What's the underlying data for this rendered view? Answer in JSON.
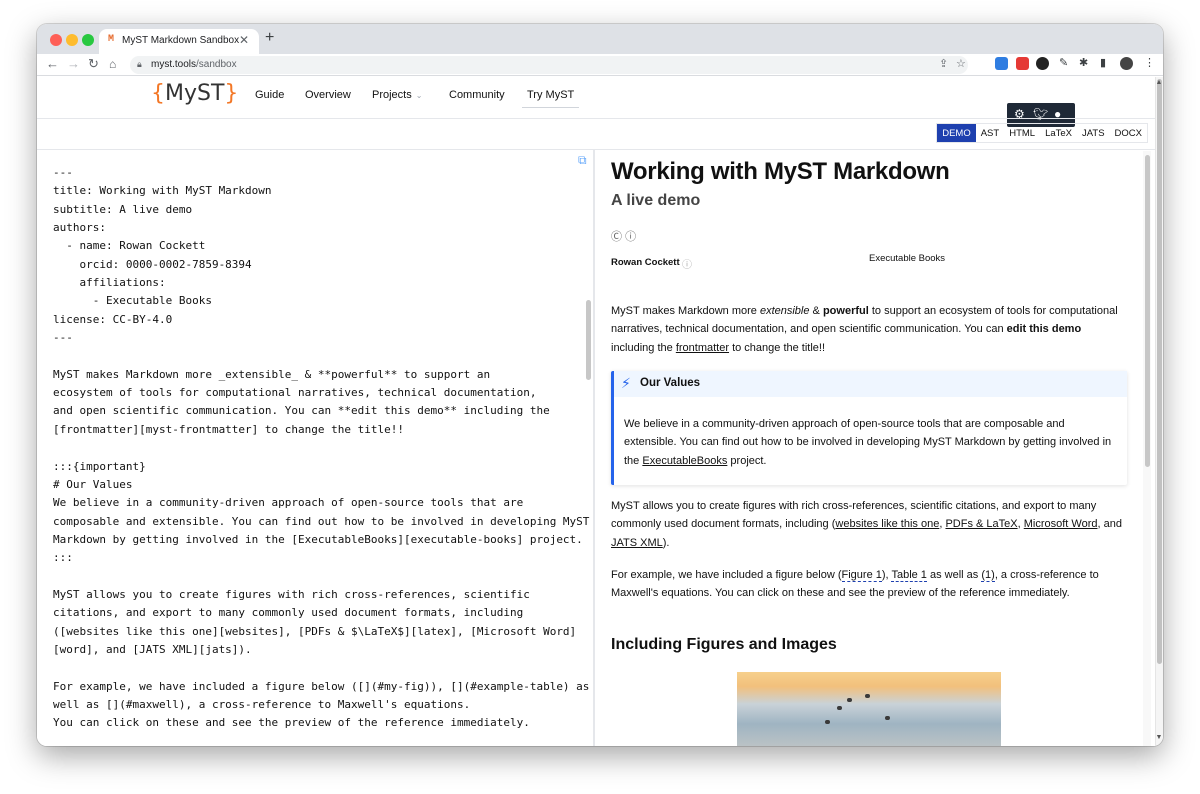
{
  "browser": {
    "tab_title": "MyST Markdown Sandbox",
    "tab_favicon": "M",
    "url_domain": "myst.tools",
    "url_path": "/sandbox"
  },
  "site": {
    "logo_left": "{",
    "logo_text": "MyST",
    "logo_right": "}",
    "nav": {
      "guide": "Guide",
      "overview": "Overview",
      "projects": "Projects",
      "community": "Community",
      "try": "Try MyST"
    }
  },
  "formats": [
    "DEMO",
    "AST",
    "HTML",
    "LaTeX",
    "JATS",
    "DOCX"
  ],
  "editor": {
    "source": "---\ntitle: Working with MyST Markdown\nsubtitle: A live demo\nauthors:\n  - name: Rowan Cockett\n    orcid: 0000-0002-7859-8394\n    affiliations:\n      - Executable Books\nlicense: CC-BY-4.0\n---\n\nMyST makes Markdown more _extensible_ & **powerful** to support an\necosystem of tools for computational narratives, technical documentation,\nand open scientific communication. You can **edit this demo** including the\n[frontmatter][myst-frontmatter] to change the title!!\n\n:::{important}\n# Our Values\nWe believe in a community-driven approach of open-source tools that are\ncomposable and extensible. You can find out how to be involved in developing MyST\nMarkdown by getting involved in the [ExecutableBooks][executable-books] project.\n:::\n\nMyST allows you to create figures with rich cross-references, scientific\ncitations, and export to many commonly used document formats, including\n([websites like this one][websites], [PDFs & $\\LaTeX$][latex], [Microsoft Word]\n[word], and [JATS XML][jats]).\n\nFor example, we have included a figure below ([](#my-fig)), [](#example-table) as\nwell as [](#maxwell), a cross-reference to Maxwell's equations.\nYou can click on these and see the preview of the reference immediately."
  },
  "preview": {
    "title": "Working with MyST Markdown",
    "subtitle": "A live demo",
    "author": "Rowan Cockett",
    "affiliation": "Executable Books",
    "p1": {
      "a": "MyST makes Markdown more ",
      "extensible": "extensible",
      "b": " & ",
      "powerful": "powerful",
      "c": " to support an ecosystem of tools for computational narratives, technical documentation, and open scientific communication. You can ",
      "edit": "edit this demo",
      "d": " including the ",
      "frontmatter": "frontmatter",
      "e": " to change the title!!"
    },
    "admonition": {
      "title": "Our Values",
      "a": "We believe in a community-driven approach of open-source tools that are composable and extensible. You can find out how to be involved in developing MyST Markdown by getting involved in the ",
      "link": "ExecutableBooks",
      "b": " project."
    },
    "p2": {
      "a": "MyST allows you to create figures with rich cross-references, scientific citations, and export to many commonly used document formats, including (",
      "websites": "websites like this one",
      "b": ", ",
      "pdfs": "PDFs & LaTeX",
      "c": ", ",
      "word": "Microsoft Word",
      "d": ", and ",
      "jats": "JATS XML",
      "e": ")."
    },
    "p3": {
      "a": "For example, we have included a figure below (",
      "fig": "Figure 1",
      "b": "), ",
      "table": "Table 1",
      "c": " as well as ",
      "eq": "(1)",
      "d": ", a cross-reference to Maxwell's equations. You can click on these and see the preview of the reference immediately."
    },
    "h2": "Including Figures and Images"
  },
  "icons": {
    "copy": "copy-icon",
    "admonition": "lightning-icon",
    "cc": "creative-commons-icon",
    "by": "attribution-icon",
    "orcid": "orcid-icon"
  },
  "colors": {
    "accent": "#1e40af",
    "brand": "#f37726",
    "admonition_border": "#2563eb"
  }
}
